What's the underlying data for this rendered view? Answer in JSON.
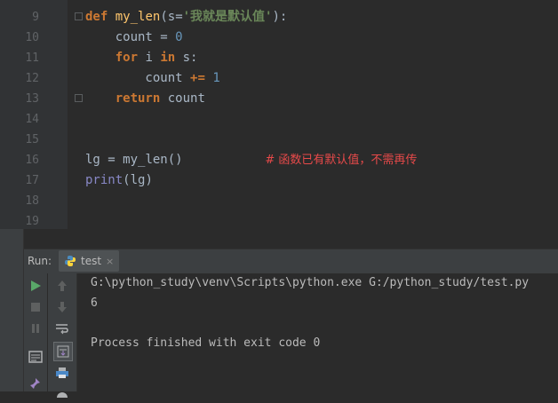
{
  "editor": {
    "lines": [
      {
        "num": "9",
        "tokens": [
          {
            "t": "def",
            "c": "kw"
          },
          {
            "t": " "
          },
          {
            "t": "my_len",
            "c": "fn"
          },
          {
            "t": "("
          },
          {
            "t": "s",
            "c": "param"
          },
          {
            "t": "="
          },
          {
            "t": "'我就是默认值'",
            "c": "str"
          },
          {
            "t": "):"
          }
        ]
      },
      {
        "num": "10",
        "tokens": [
          {
            "t": "    count "
          },
          {
            "t": "="
          },
          {
            "t": " "
          },
          {
            "t": "0",
            "c": "num"
          }
        ]
      },
      {
        "num": "11",
        "tokens": [
          {
            "t": "    "
          },
          {
            "t": "for",
            "c": "kw"
          },
          {
            "t": " i "
          },
          {
            "t": "in",
            "c": "kw"
          },
          {
            "t": " s:"
          }
        ]
      },
      {
        "num": "12",
        "tokens": [
          {
            "t": "        count "
          },
          {
            "t": "+=",
            "c": "kw"
          },
          {
            "t": " "
          },
          {
            "t": "1",
            "c": "num"
          }
        ]
      },
      {
        "num": "13",
        "tokens": [
          {
            "t": "    "
          },
          {
            "t": "return",
            "c": "kw"
          },
          {
            "t": " count"
          }
        ]
      },
      {
        "num": "14",
        "tokens": []
      },
      {
        "num": "15",
        "tokens": []
      },
      {
        "num": "16",
        "tokens": [
          {
            "t": "lg "
          },
          {
            "t": "="
          },
          {
            "t": " my_len()           "
          },
          {
            "t": "# 函数已有默认值，不需再传",
            "c": "cm"
          }
        ]
      },
      {
        "num": "17",
        "tokens": [
          {
            "t": "print",
            "c": "fn2"
          },
          {
            "t": "(lg)"
          }
        ]
      },
      {
        "num": "18",
        "tokens": []
      },
      {
        "num": "19",
        "tokens": []
      }
    ]
  },
  "run_panel": {
    "label": "Run:",
    "tab_label": "test",
    "tab_close": "×",
    "console_lines": [
      "G:\\python_study\\venv\\Scripts\\python.exe G:/python_study/test.py",
      "6",
      "",
      "Process finished with exit code 0"
    ]
  },
  "icons": {
    "run": "play-icon",
    "stop": "stop-icon",
    "pause": "pause-icon",
    "up": "arrow-up-icon",
    "down": "arrow-down-icon",
    "wrap": "soft-wrap-icon",
    "scroll_end": "scroll-to-end-icon",
    "print": "print-icon",
    "layout": "layout-icon",
    "pin": "pin-icon"
  },
  "colors": {
    "keyword": "#cc7832",
    "number": "#6897bb",
    "string": "#6a8759",
    "comment": "#e84a4a",
    "run_green": "#59a869"
  }
}
